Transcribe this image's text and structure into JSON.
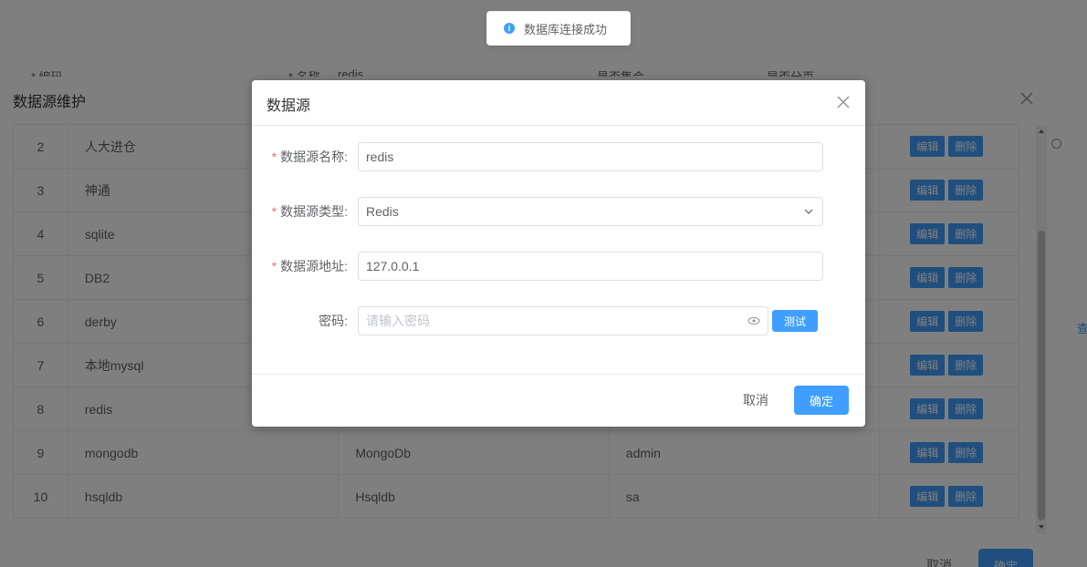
{
  "toast": {
    "message": "数据库连接成功",
    "icon": "info-icon"
  },
  "background": {
    "form": {
      "label_1": "* 编码",
      "label_2": "* 名称",
      "value_2": "redis",
      "label_3": "是否集合",
      "label_4": "是否分页"
    },
    "side_link": "查"
  },
  "outer_dialog": {
    "title": "数据源维护",
    "rows": [
      {
        "id": "2",
        "name": "人大进仓",
        "type": "",
        "user": ""
      },
      {
        "id": "3",
        "name": "神通",
        "type": "",
        "user": ""
      },
      {
        "id": "4",
        "name": "sqlite",
        "type": "",
        "user": ""
      },
      {
        "id": "5",
        "name": "DB2",
        "type": "",
        "user": ""
      },
      {
        "id": "6",
        "name": "derby",
        "type": "",
        "user": ""
      },
      {
        "id": "7",
        "name": "本地mysql",
        "type": "",
        "user": ""
      },
      {
        "id": "8",
        "name": "redis",
        "type": "",
        "user": ""
      },
      {
        "id": "9",
        "name": "mongodb",
        "type": "MongoDb",
        "user": "admin"
      },
      {
        "id": "10",
        "name": "hsqldb",
        "type": "Hsqldb",
        "user": "sa"
      }
    ],
    "edit_label": "编辑",
    "delete_label": "删除",
    "footer": {
      "cancel": "取消",
      "ok": "确定"
    }
  },
  "dialog": {
    "title": "数据源",
    "fields": {
      "name": {
        "label": "数据源名称:",
        "value": "redis",
        "required": true
      },
      "type": {
        "label": "数据源类型:",
        "value": "Redis",
        "required": true
      },
      "address": {
        "label": "数据源地址:",
        "value": "127.0.0.1",
        "required": true
      },
      "password": {
        "label": "密码:",
        "placeholder": "请输入密码",
        "required": false
      }
    },
    "test_button": "测试",
    "footer": {
      "cancel": "取消",
      "ok": "确定"
    }
  },
  "colors": {
    "primary": "#409eff",
    "required": "#f56c6c",
    "mask": "rgba(0,0,0,0.5)"
  }
}
